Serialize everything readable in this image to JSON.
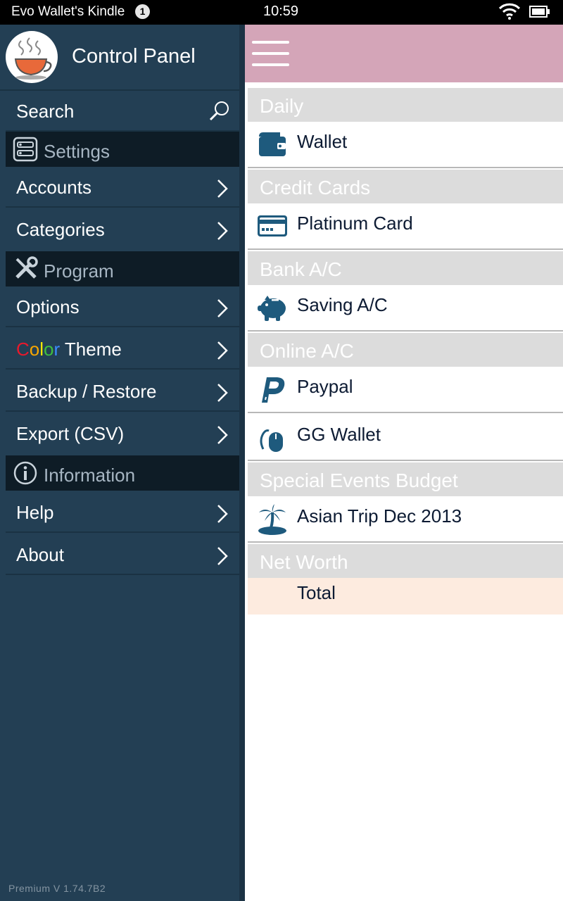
{
  "status_bar": {
    "device_name": "Evo Wallet's Kindle",
    "notification_count": "1",
    "time": "10:59"
  },
  "drawer": {
    "title": "Control Panel",
    "search_label": "Search",
    "sections": {
      "settings": "Settings",
      "program": "Program",
      "information": "Information"
    },
    "items": {
      "accounts": "Accounts",
      "categories": "Categories",
      "options": "Options",
      "color_theme_prefix": [
        "C",
        "o",
        "l",
        "o",
        "r"
      ],
      "color_theme_suffix": " Theme",
      "backup_restore": "Backup / Restore",
      "export_csv": "Export (CSV)",
      "help": "Help",
      "about": "About"
    },
    "version": "Premium  V  1.74.7B2"
  },
  "colors": {
    "appbar": "#d4a5b8",
    "drawer_bg": "#233f54",
    "icon_blue": "#1e5a7d",
    "rainbow": [
      "#e8192c",
      "#f7a600",
      "#f7e600",
      "#3fbf3f",
      "#3c8cff"
    ]
  },
  "accounts": {
    "groups": [
      {
        "title": "Daily",
        "items": [
          {
            "name": "Wallet",
            "icon": "wallet-icon"
          }
        ]
      },
      {
        "title": "Credit Cards",
        "items": [
          {
            "name": "Platinum Card",
            "icon": "credit-card-icon"
          }
        ]
      },
      {
        "title": "Bank A/C",
        "items": [
          {
            "name": "Saving A/C",
            "icon": "piggy-bank-icon"
          }
        ]
      },
      {
        "title": "Online A/C",
        "items": [
          {
            "name": "Paypal",
            "icon": "paypal-icon"
          },
          {
            "name": "GG Wallet",
            "icon": "mouse-icon"
          }
        ]
      },
      {
        "title": "Special Events Budget",
        "items": [
          {
            "name": "Asian Trip Dec 2013",
            "icon": "island-icon"
          }
        ]
      },
      {
        "title": "Net Worth",
        "items": []
      }
    ],
    "total_label": "Total"
  }
}
